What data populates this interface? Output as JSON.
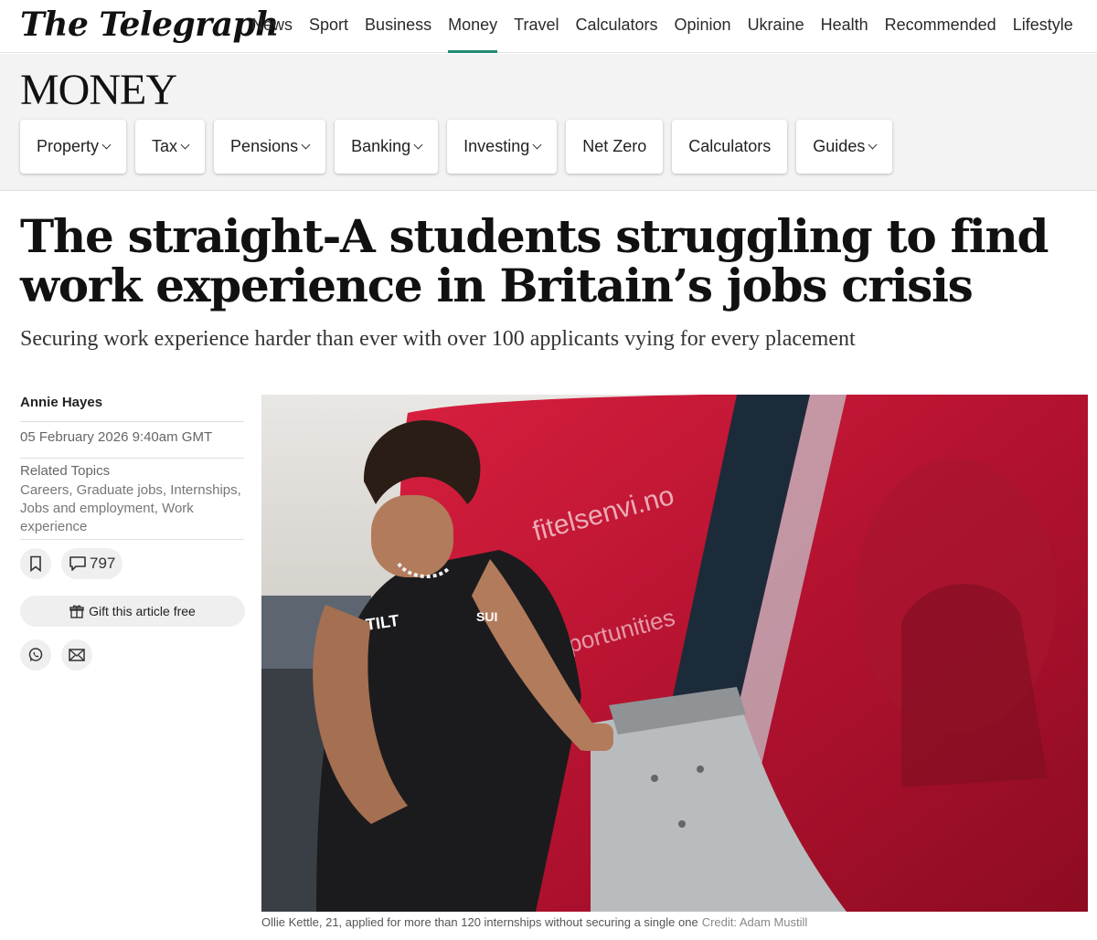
{
  "header": {
    "logo": "The Telegraph",
    "nav": [
      "News",
      "Sport",
      "Business",
      "Money",
      "Travel",
      "Calculators",
      "Opinion",
      "Ukraine",
      "Health",
      "Recommended",
      "Lifestyle"
    ],
    "active_nav": "Money",
    "accent_color": "#1f8a74"
  },
  "section": {
    "title": "MONEY",
    "subnav": [
      {
        "label": "Property",
        "dropdown": true
      },
      {
        "label": "Tax",
        "dropdown": true
      },
      {
        "label": "Pensions",
        "dropdown": true
      },
      {
        "label": "Banking",
        "dropdown": true
      },
      {
        "label": "Investing",
        "dropdown": true
      },
      {
        "label": "Net Zero",
        "dropdown": false
      },
      {
        "label": "Calculators",
        "dropdown": false
      },
      {
        "label": "Guides",
        "dropdown": true
      }
    ]
  },
  "article": {
    "headline": "The straight-A students struggling to find work experience in Britain’s jobs crisis",
    "standfirst": "Securing work experience harder than ever with over 100 applicants vying for every placement",
    "author": "Annie Hayes",
    "date": "05 February 2026 9:40am GMT",
    "related_topics_label": "Related Topics",
    "related_topics": "Careers, Graduate jobs, Internships, Jobs and employment, Work experience",
    "comment_count": "797",
    "gift_label": "Gift this article free",
    "share_icons": [
      "whatsapp-icon",
      "email-icon"
    ],
    "image": {
      "caption": "Ollie Kettle, 21, applied for more than 120 internships without securing a single one",
      "credit": "Credit: Adam Mustill",
      "shirt_text": "TILT",
      "hull_text": "fitelsenvi.no",
      "hull_text_2": "opportunities",
      "badge_text": "SUI"
    }
  }
}
